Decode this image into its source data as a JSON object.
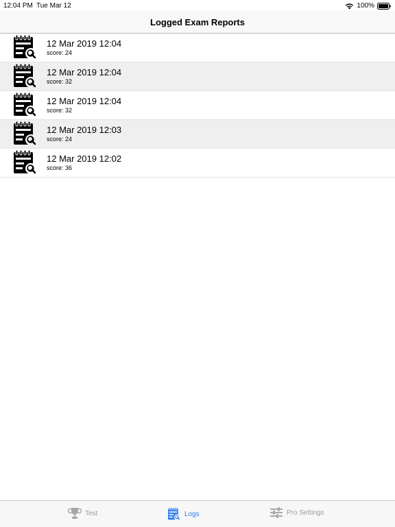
{
  "status": {
    "time": "12:04 PM",
    "date": "Tue Mar 12",
    "battery": "100%"
  },
  "nav": {
    "title": "Logged Exam Reports"
  },
  "logs": [
    {
      "datetime": "12 Mar 2019 12:04",
      "score": "score: 24",
      "icon": "calendar-search-icon"
    },
    {
      "datetime": "12 Mar 2019 12:04",
      "score": "score: 32",
      "icon": "calendar-search-icon"
    },
    {
      "datetime": "12 Mar 2019 12:04",
      "score": "score: 32",
      "icon": "calendar-search-icon"
    },
    {
      "datetime": "12 Mar 2019 12:03",
      "score": "score: 24",
      "icon": "calendar-search-icon"
    },
    {
      "datetime": "12 Mar 2019 12:02",
      "score": "score: 36",
      "icon": "calendar-search-icon"
    }
  ],
  "tabs": [
    {
      "label": "Test",
      "icon": "trophy-icon",
      "active": false
    },
    {
      "label": "Logs",
      "icon": "calendar-search-icon",
      "active": true
    },
    {
      "label": "Pro Settings",
      "icon": "sliders-icon",
      "active": false
    }
  ],
  "colors": {
    "accent": "#2f7ff0",
    "inactive_tab": "#9b9b9b",
    "row_alt": "#efefef"
  }
}
